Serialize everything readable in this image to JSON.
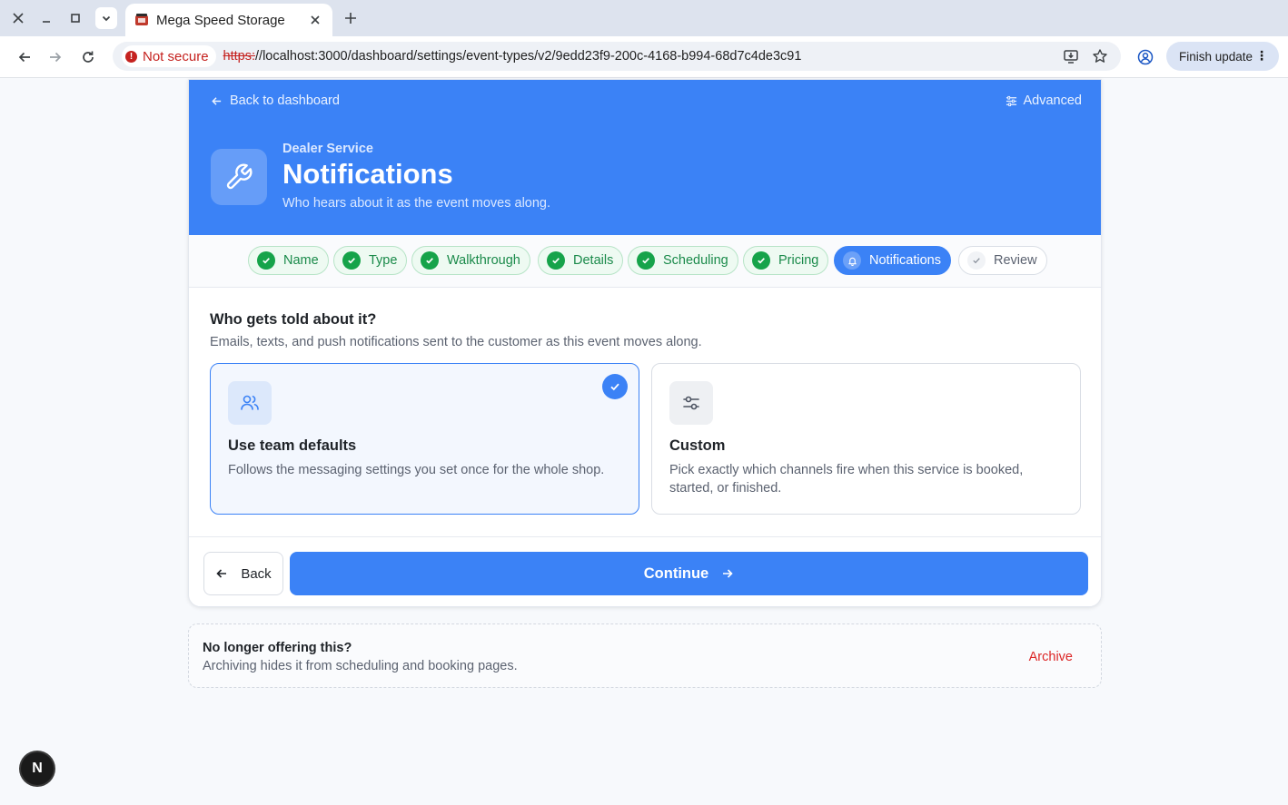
{
  "browser": {
    "tab_title": "Mega Speed Storage",
    "security_label": "Not secure",
    "url_scheme": "https:",
    "url_rest": "//localhost:3000/dashboard/settings/event-types/v2/9edd23f9-200c-4168-b994-68d7c4de3c91",
    "finish_update_label": "Finish update"
  },
  "header": {
    "back_label": "Back to dashboard",
    "advanced_label": "Advanced",
    "eyebrow": "Dealer Service",
    "title": "Notifications",
    "subtitle": "Who hears about it as the event moves along."
  },
  "steps": [
    {
      "label": "Name",
      "state": "done"
    },
    {
      "label": "Type",
      "state": "done"
    },
    {
      "label": "Walkthrough",
      "state": "done"
    },
    {
      "label": "Details",
      "state": "done"
    },
    {
      "label": "Scheduling",
      "state": "done"
    },
    {
      "label": "Pricing",
      "state": "done"
    },
    {
      "label": "Notifications",
      "state": "active"
    },
    {
      "label": "Review",
      "state": "todo"
    }
  ],
  "section": {
    "title": "Who gets told about it?",
    "subtitle": "Emails, texts, and push notifications sent to the customer as this event moves along."
  },
  "options": [
    {
      "title": "Use team defaults",
      "description": "Follows the messaging settings you set once for the whole shop.",
      "selected": true,
      "icon": "users-icon"
    },
    {
      "title": "Custom",
      "description": "Pick exactly which channels fire when this service is booked, started, or finished.",
      "selected": false,
      "icon": "sliders-icon"
    }
  ],
  "footer": {
    "back_label": "Back",
    "continue_label": "Continue"
  },
  "archive": {
    "title": "No longer offering this?",
    "subtitle": "Archiving hides it from scheduling and booking pages.",
    "action_label": "Archive"
  },
  "dev_badge": "N",
  "colors": {
    "primary": "#3b82f6",
    "success": "#16a34a",
    "danger": "#dc2626"
  }
}
